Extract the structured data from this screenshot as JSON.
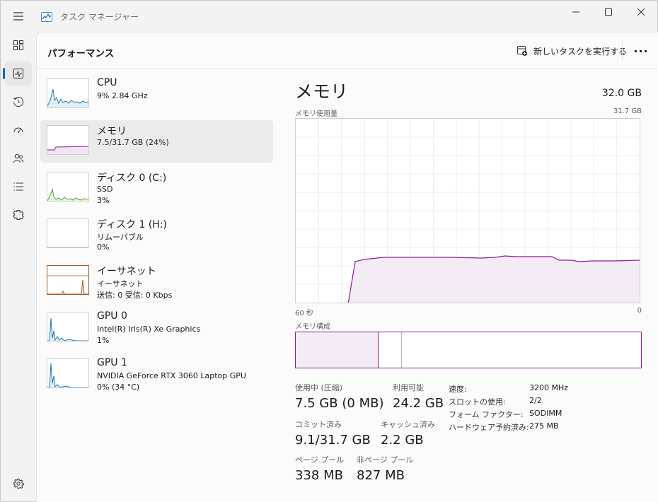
{
  "window": {
    "title": "タスク マネージャー",
    "minimize_glyph": "—",
    "maximize_glyph": "☐",
    "close_glyph": "✕"
  },
  "nav": {
    "items": [
      {
        "icon": "processes-icon"
      },
      {
        "icon": "performance-icon",
        "active": true
      },
      {
        "icon": "app-history-icon"
      },
      {
        "icon": "startup-apps-icon"
      },
      {
        "icon": "users-icon"
      },
      {
        "icon": "details-icon"
      },
      {
        "icon": "services-icon"
      }
    ],
    "settings_icon": "settings-icon"
  },
  "header": {
    "title": "パフォーマンス",
    "run_task_label": "新しいタスクを実行する",
    "more_label": "···"
  },
  "resources": [
    {
      "name": "CPU",
      "line2": "9%  2.84 GHz",
      "line3": "",
      "color": "#1a7ab8",
      "selected": false
    },
    {
      "name": "メモリ",
      "line2": "7.5/31.7 GB (24%)",
      "line3": "",
      "color": "#8c1c97",
      "selected": true
    },
    {
      "name": "ディスク 0 (C:)",
      "line2": "SSD",
      "line3": "3%",
      "color": "#4da62c",
      "selected": false
    },
    {
      "name": "ディスク 1 (H:)",
      "line2": "リムーバブル",
      "line3": "0%",
      "color": "#4da62c",
      "selected": false
    },
    {
      "name": "イーサネット",
      "line2": "イーサネット",
      "line3": "送信: 0 受信: 0 Kbps",
      "color": "#a7581c",
      "selected": false
    },
    {
      "name": "GPU 0",
      "line2": "Intel(R) Iris(R) Xe Graphics",
      "line3": "1%",
      "color": "#1a7ab8",
      "selected": false
    },
    {
      "name": "GPU 1",
      "line2": "NVIDIA GeForce RTX 3060 Laptop GPU",
      "line3": "0%  (34 °C)",
      "color": "#1a7ab8",
      "selected": false
    }
  ],
  "detail": {
    "title": "メモリ",
    "total": "32.0 GB",
    "usage_label": "メモリ使用量",
    "usage_max": "31.7 GB",
    "time_left": "60 秒",
    "time_right": "0",
    "composition_label": "メモリ構成",
    "accent": "#8c1c97",
    "stats": {
      "in_use_label": "使用中 (圧縮)",
      "in_use_value": "7.5 GB (0 MB)",
      "available_label": "利用可能",
      "available_value": "24.2 GB",
      "committed_label": "コミット済み",
      "committed_value": "9.1/31.7 GB",
      "cached_label": "キャッシュ済み",
      "cached_value": "2.2 GB",
      "paged_label": "ページ プール",
      "paged_value": "338 MB",
      "nonpaged_label": "非ページ プール",
      "nonpaged_value": "827 MB"
    },
    "specs": {
      "speed_label": "速度:",
      "speed_value": "3200 MHz",
      "slots_label": "スロットの使用:",
      "slots_value": "2/2",
      "form_label": "フォーム ファクター:",
      "form_value": "SODIMM",
      "reserved_label": "ハードウェア予約済み:",
      "reserved_value": "275 MB"
    }
  }
}
